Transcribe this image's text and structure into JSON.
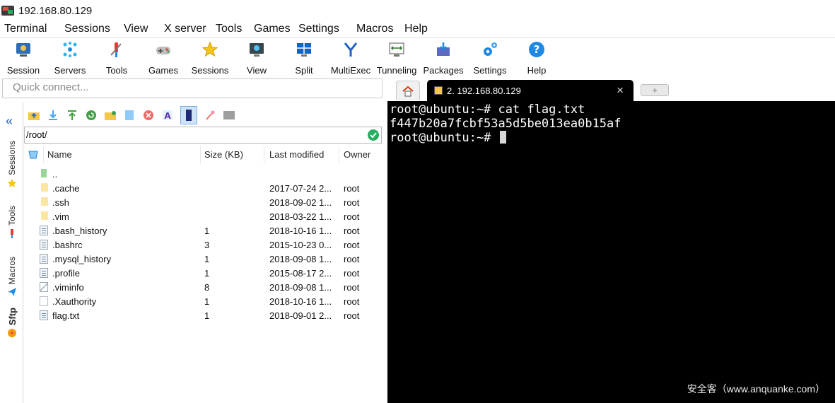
{
  "window": {
    "title": "192.168.80.129"
  },
  "menu": [
    "Terminal",
    "Sessions",
    "View",
    "X server",
    "Tools",
    "Games",
    "Settings",
    "Macros",
    "Help"
  ],
  "toolbar": [
    {
      "label": "Session",
      "icon": "session-icon"
    },
    {
      "label": "Servers",
      "icon": "servers-icon"
    },
    {
      "label": "Tools",
      "icon": "tools-icon"
    },
    {
      "label": "Games",
      "icon": "games-icon"
    },
    {
      "label": "Sessions",
      "icon": "star-icon"
    },
    {
      "label": "View",
      "icon": "view-icon"
    },
    {
      "label": "Split",
      "icon": "split-icon"
    },
    {
      "label": "MultiExec",
      "icon": "multiexec-icon"
    },
    {
      "label": "Tunneling",
      "icon": "tunneling-icon"
    },
    {
      "label": "Packages",
      "icon": "packages-icon"
    },
    {
      "label": "Settings",
      "icon": "settings-icon"
    },
    {
      "label": "Help",
      "icon": "help-icon"
    }
  ],
  "quick_connect": {
    "placeholder": "Quick connect..."
  },
  "side_tabs": [
    "Sessions",
    "Tools",
    "Macros",
    "Sftp"
  ],
  "sftp": {
    "path": "/root/",
    "columns": [
      "Name",
      "Size (KB)",
      "Last modified",
      "Owner"
    ],
    "files": [
      {
        "name": "..",
        "size": "",
        "modified": "",
        "owner": "",
        "kind": "up"
      },
      {
        "name": ".cache",
        "size": "",
        "modified": "2017-07-24 2...",
        "owner": "root",
        "kind": "folder"
      },
      {
        "name": ".ssh",
        "size": "",
        "modified": "2018-09-02 1...",
        "owner": "root",
        "kind": "folder"
      },
      {
        "name": ".vim",
        "size": "",
        "modified": "2018-03-22 1...",
        "owner": "root",
        "kind": "folder"
      },
      {
        "name": ".bash_history",
        "size": "1",
        "modified": "2018-10-16 1...",
        "owner": "root",
        "kind": "doc"
      },
      {
        "name": ".bashrc",
        "size": "3",
        "modified": "2015-10-23 0...",
        "owner": "root",
        "kind": "doc"
      },
      {
        "name": ".mysql_history",
        "size": "1",
        "modified": "2018-09-08 1...",
        "owner": "root",
        "kind": "doc"
      },
      {
        "name": ".profile",
        "size": "1",
        "modified": "2015-08-17 2...",
        "owner": "root",
        "kind": "doc"
      },
      {
        "name": ".viminfo",
        "size": "8",
        "modified": "2018-09-08 1...",
        "owner": "root",
        "kind": "vi"
      },
      {
        "name": ".Xauthority",
        "size": "1",
        "modified": "2018-10-16 1...",
        "owner": "root",
        "kind": "blank"
      },
      {
        "name": "flag.txt",
        "size": "1",
        "modified": "2018-09-01 2...",
        "owner": "root",
        "kind": "doc"
      }
    ]
  },
  "terminal_tab": {
    "label": "2. 192.168.80.129",
    "close": "×",
    "new_tab": "+"
  },
  "terminal": {
    "lines": [
      "root@ubuntu:~# cat flag.txt",
      "f447b20a7fcbf53a5d5be013ea0b15af",
      "root@ubuntu:~# "
    ]
  },
  "watermark": "安全客（www.anquanke.com）"
}
